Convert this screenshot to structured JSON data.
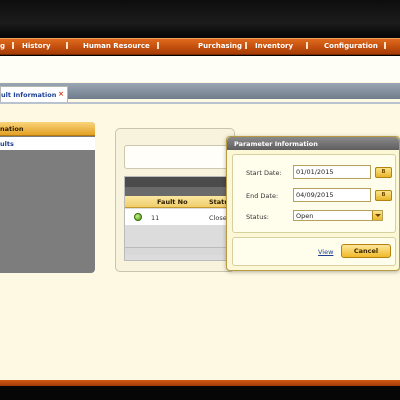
{
  "nav": {
    "items": [
      {
        "label": "g"
      },
      {
        "label": "History"
      },
      {
        "label": "Human Resource"
      },
      {
        "label": "Purchasing"
      },
      {
        "label": "Inventory"
      },
      {
        "label": "Configuration"
      }
    ]
  },
  "tab": {
    "label": "ult Information",
    "close": "×"
  },
  "left_panel": {
    "header": "nation",
    "item": "ults"
  },
  "grid": {
    "headers": [
      "Fault No",
      "Statu"
    ],
    "rows": [
      {
        "fault_no": "11",
        "status": "Closed"
      }
    ]
  },
  "dialog": {
    "title": "Parameter Information",
    "start_date_label": "Start Date:",
    "start_date_value": "01/01/2015",
    "end_date_label": "End Date:",
    "end_date_value": "04/09/2015",
    "status_label": "Status:",
    "status_value": "Open",
    "calendar_button": "B",
    "view_link": "View",
    "cancel_button": "Cancel"
  },
  "colors": {
    "nav_orange": "#c24e0e",
    "accent_gold": "#f0b928",
    "link_blue": "#1c3f94",
    "page_cream": "#fdf9e2"
  }
}
